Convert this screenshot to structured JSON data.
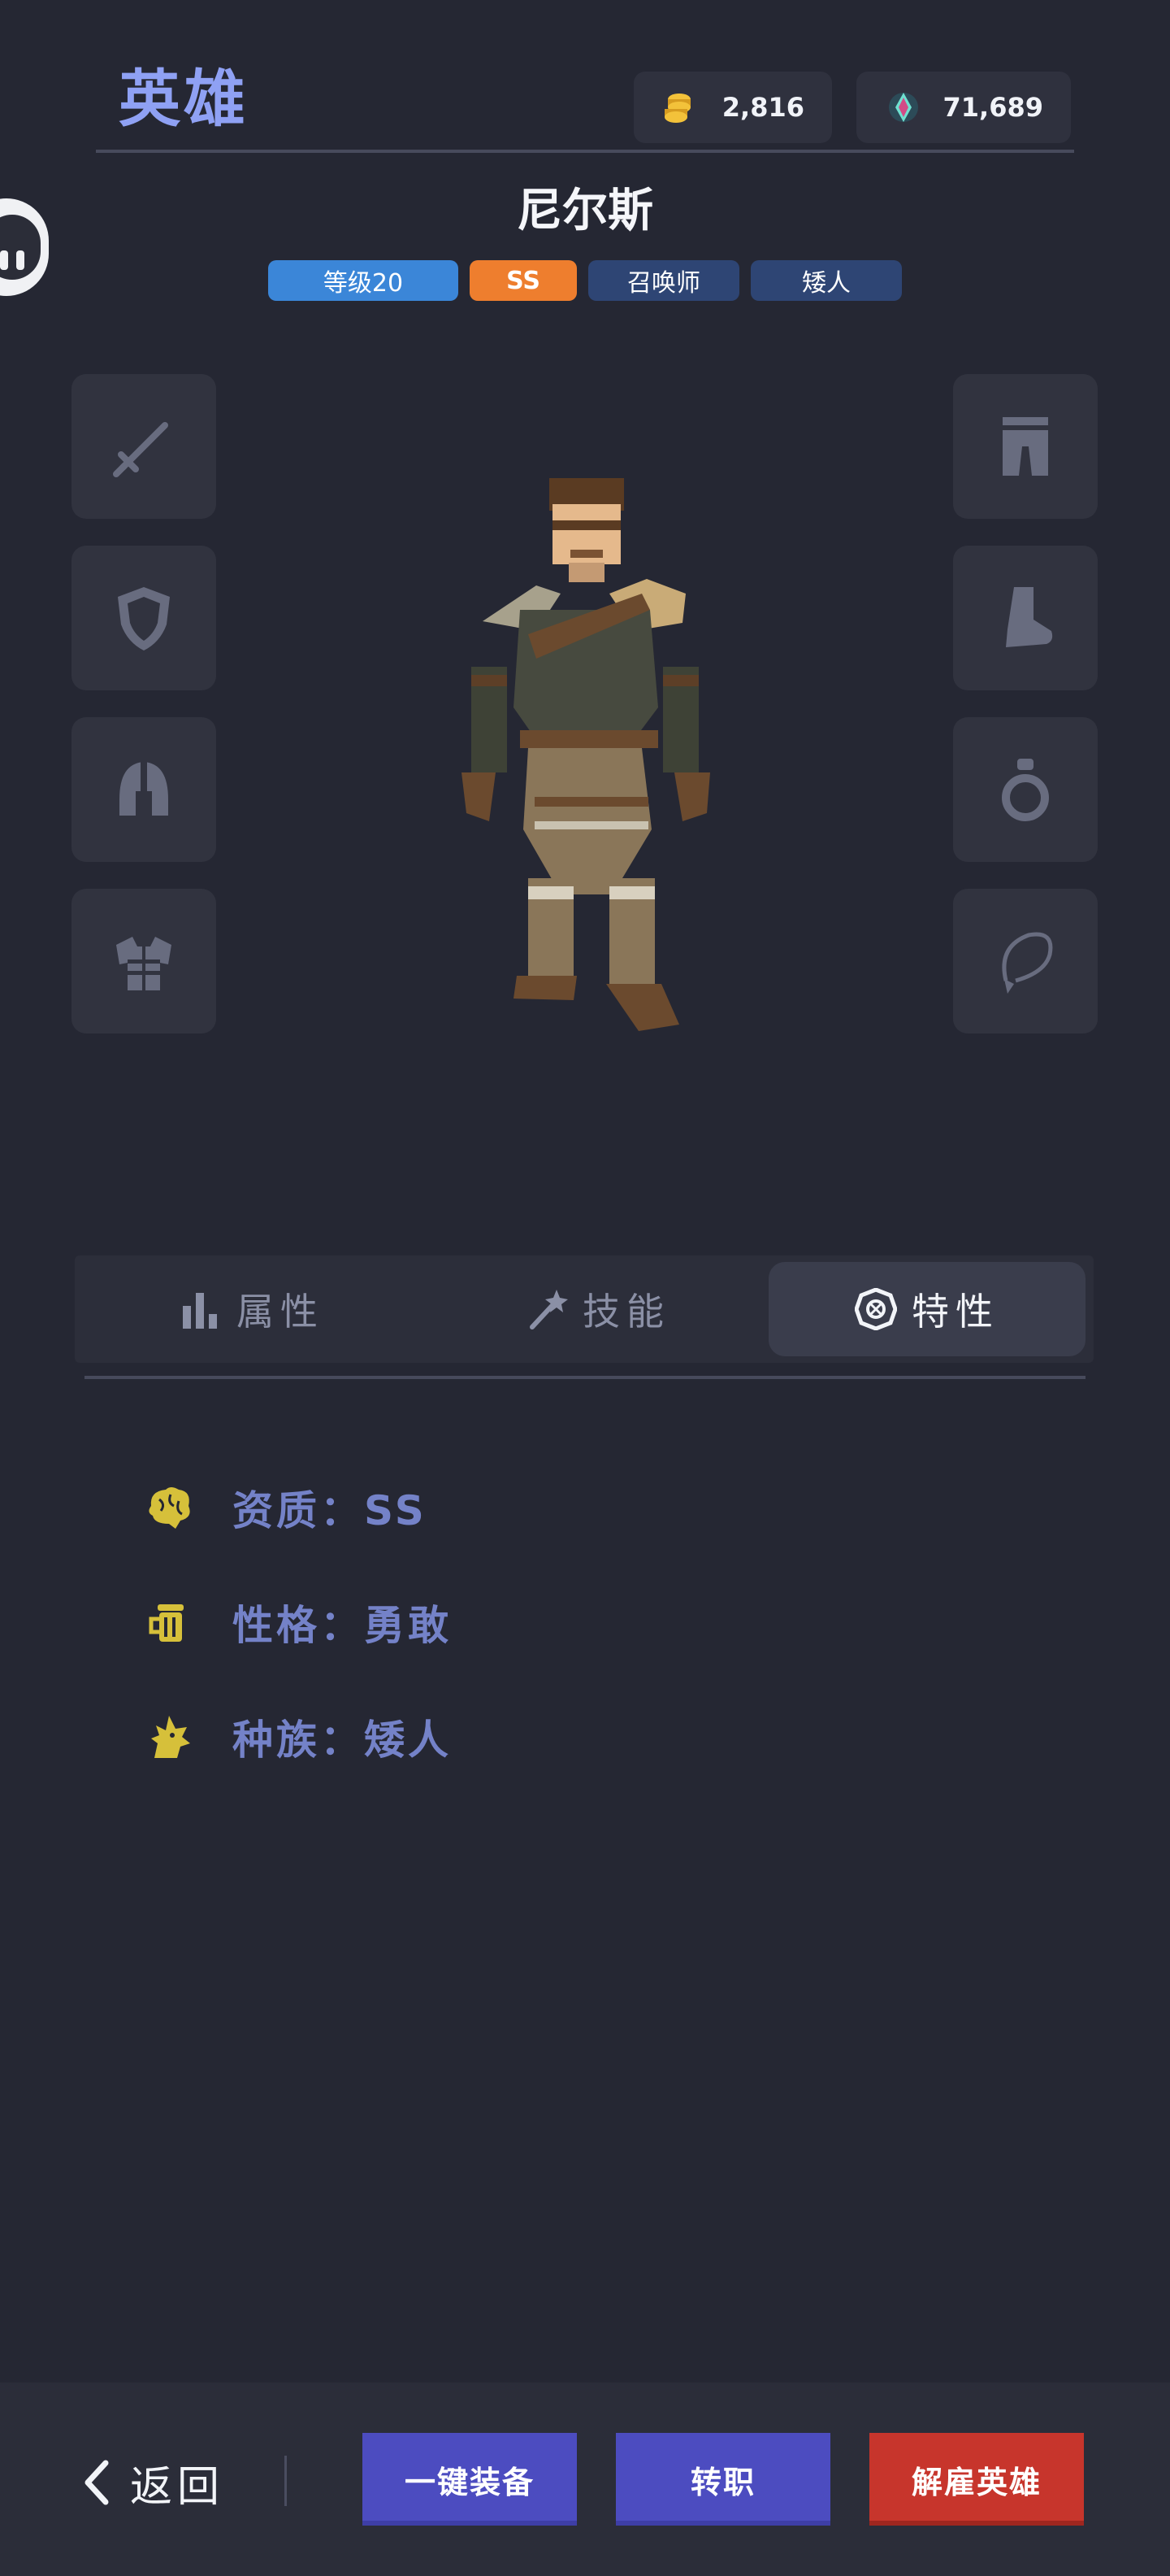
{
  "header": {
    "title": "英雄",
    "currencies": [
      {
        "icon": "gold-coins-icon",
        "value": "2,816"
      },
      {
        "icon": "crystal-gem-icon",
        "value": "71,689"
      }
    ]
  },
  "hero": {
    "name": "尼尔斯",
    "tags": {
      "level": "等级20",
      "grade": "SS",
      "class": "召唤师",
      "race": "矮人"
    }
  },
  "equipment_slots": {
    "left": [
      "sword-icon",
      "shield-icon",
      "helmet-icon",
      "chest-armor-icon"
    ],
    "right": [
      "pants-icon",
      "boots-icon",
      "ring-icon",
      "necklace-icon"
    ]
  },
  "tabs": [
    {
      "label": "属性",
      "icon": "bar-chart-icon",
      "active": false
    },
    {
      "label": "技能",
      "icon": "magic-wand-icon",
      "active": false
    },
    {
      "label": "特性",
      "icon": "trait-badge-icon",
      "active": true
    }
  ],
  "traits": [
    {
      "icon": "brain-icon",
      "label": "资质：SS"
    },
    {
      "icon": "mug-icon",
      "label": "性格：勇敢"
    },
    {
      "icon": "dragon-icon",
      "label": "种族：矮人"
    }
  ],
  "footer": {
    "back_label": "返回",
    "buttons": {
      "equip_all": "一键装备",
      "change_class": "转职",
      "dismiss": "解雇英雄"
    }
  },
  "colors": {
    "background": "#252733",
    "accent_title": "#8fa1f4",
    "tag_level": "#3b86d8",
    "tag_grade": "#ee7e2e",
    "tag_info": "#2e4574",
    "trait_icon": "#d6c03a",
    "button_blue": "#4c4cc0",
    "button_red": "#c7352c"
  }
}
